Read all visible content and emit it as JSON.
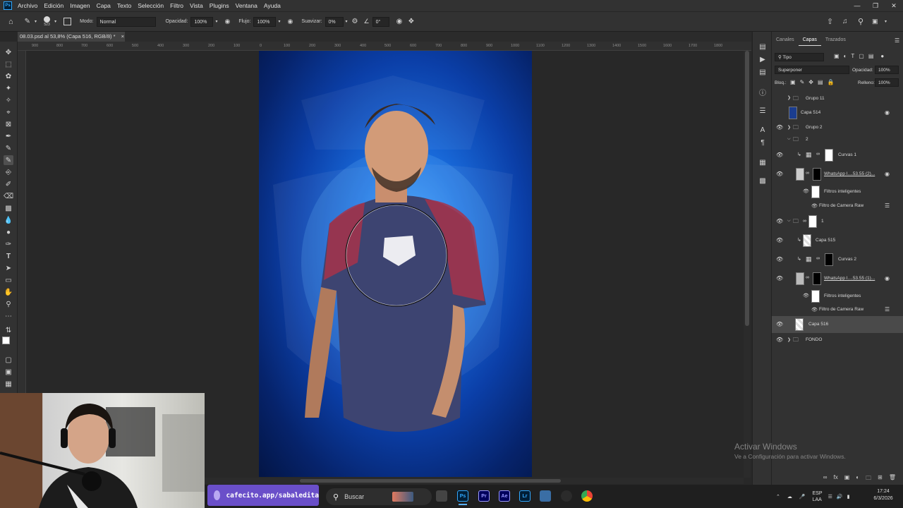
{
  "app": {
    "menu": [
      "Archivo",
      "Edición",
      "Imagen",
      "Capa",
      "Texto",
      "Selección",
      "Filtro",
      "Vista",
      "Plugins",
      "Ventana",
      "Ayuda"
    ],
    "logo": "Ps"
  },
  "options": {
    "brush_size": "523",
    "mode_label": "Modo:",
    "mode_value": "Normal",
    "opacity_label": "Opacidad:",
    "opacity_value": "100%",
    "flow_label": "Flujo:",
    "flow_value": "100%",
    "smooth_label": "Suavizar:",
    "smooth_value": "0%",
    "angle_value": "0°"
  },
  "document": {
    "tab_title": "08.03.psd al 53,8% (Capa 516, RGB/8) *",
    "close_glyph": "×"
  },
  "ruler": {
    "ticks": [
      "900",
      "800",
      "700",
      "600",
      "500",
      "400",
      "300",
      "200",
      "100",
      "0",
      "100",
      "200",
      "300",
      "400",
      "500",
      "600",
      "700",
      "800",
      "900",
      "1000",
      "1100",
      "1200",
      "1300",
      "1400",
      "1500",
      "1600",
      "1700",
      "1800"
    ]
  },
  "panel": {
    "tabs": [
      "Canales",
      "Capas",
      "Trazados"
    ],
    "active_tab": "Capas",
    "filter_kind": "Tipo",
    "blend_mode": "Superponer",
    "opacity_label": "Opacidad:",
    "opacity_value": "100%",
    "lock_label": "Bloq.:",
    "fill_label": "Relleno:",
    "fill_value": "100%",
    "layers": [
      {
        "name": "Grupo 11",
        "kind": "group"
      },
      {
        "name": "Capa 514",
        "kind": "layer"
      },
      {
        "name": "Grupo 2",
        "kind": "group"
      },
      {
        "name": "2",
        "kind": "group"
      },
      {
        "name": "Curvas 1",
        "kind": "adjustment"
      },
      {
        "name": "WhatsApp I....53.55 (2)...",
        "kind": "smart"
      },
      {
        "name": "Filtros inteligentes",
        "kind": "filter"
      },
      {
        "name": "Filtro de Camera Raw",
        "kind": "filter"
      },
      {
        "name": "1",
        "kind": "group"
      },
      {
        "name": "Capa 515",
        "kind": "layer"
      },
      {
        "name": "Curvas 2",
        "kind": "adjustment"
      },
      {
        "name": "WhatsApp I....53.55 (1)...",
        "kind": "smart"
      },
      {
        "name": "Filtros inteligentes",
        "kind": "filter"
      },
      {
        "name": "Filtro de Camera Raw",
        "kind": "filter"
      },
      {
        "name": "Capa 516",
        "kind": "layer",
        "selected": true
      },
      {
        "name": "FONDO",
        "kind": "group"
      }
    ]
  },
  "watermark": {
    "title": "Activar Windows",
    "subtitle": "Ve a Configuración para activar Windows."
  },
  "overlay": {
    "cafecito": "cafecito.app/sabaledita"
  },
  "taskbar": {
    "search_placeholder": "Buscar",
    "apps": [
      "Ps",
      "Pr",
      "Ae",
      "Lr"
    ],
    "lang_top": "ESP",
    "lang_bottom": "LAA",
    "time": "17:24",
    "date": "6/3/2026"
  },
  "colors": {
    "ps_blue": "#31a8ff",
    "pr_purple": "#9999ff",
    "ae_violet": "#9999ff",
    "lr_blue": "#31a8ff",
    "cafecito_purple": "#6a4fc9"
  }
}
